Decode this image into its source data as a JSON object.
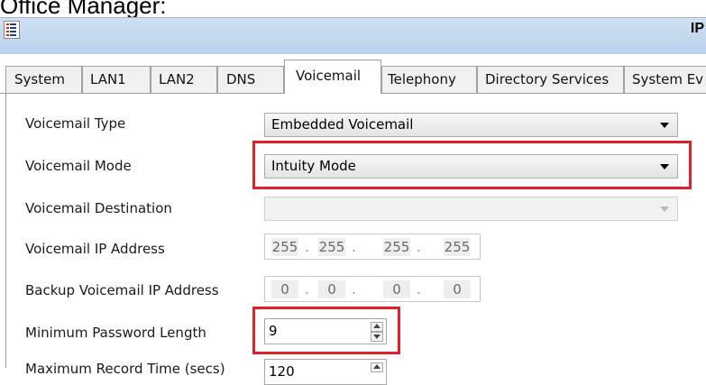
{
  "caption": "Office Manager:",
  "window": {
    "title": "IP"
  },
  "tabs": [
    {
      "label": "System"
    },
    {
      "label": "LAN1"
    },
    {
      "label": "LAN2"
    },
    {
      "label": "DNS"
    },
    {
      "label": "Voicemail",
      "active": true
    },
    {
      "label": "Telephony"
    },
    {
      "label": "Directory Services"
    },
    {
      "label": "System Ev"
    }
  ],
  "form": {
    "voicemail_type": {
      "label": "Voicemail Type",
      "value": "Embedded Voicemail"
    },
    "voicemail_mode": {
      "label": "Voicemail Mode",
      "value": "Intuity Mode"
    },
    "voicemail_destination": {
      "label": "Voicemail Destination",
      "value": ""
    },
    "voicemail_ip": {
      "label": "Voicemail IP Address",
      "octets": [
        "255",
        "255",
        "255",
        "255"
      ]
    },
    "backup_ip": {
      "label": "Backup Voicemail IP Address",
      "octets": [
        "0",
        "0",
        "0",
        "0"
      ]
    },
    "min_password": {
      "label": "Minimum Password Length",
      "value": "9"
    },
    "next_row": {
      "label": "Maximum Record Time (secs)",
      "value": "120"
    }
  },
  "colors": {
    "highlight": "#e0202a",
    "titlebar": "#c4d9ef"
  }
}
